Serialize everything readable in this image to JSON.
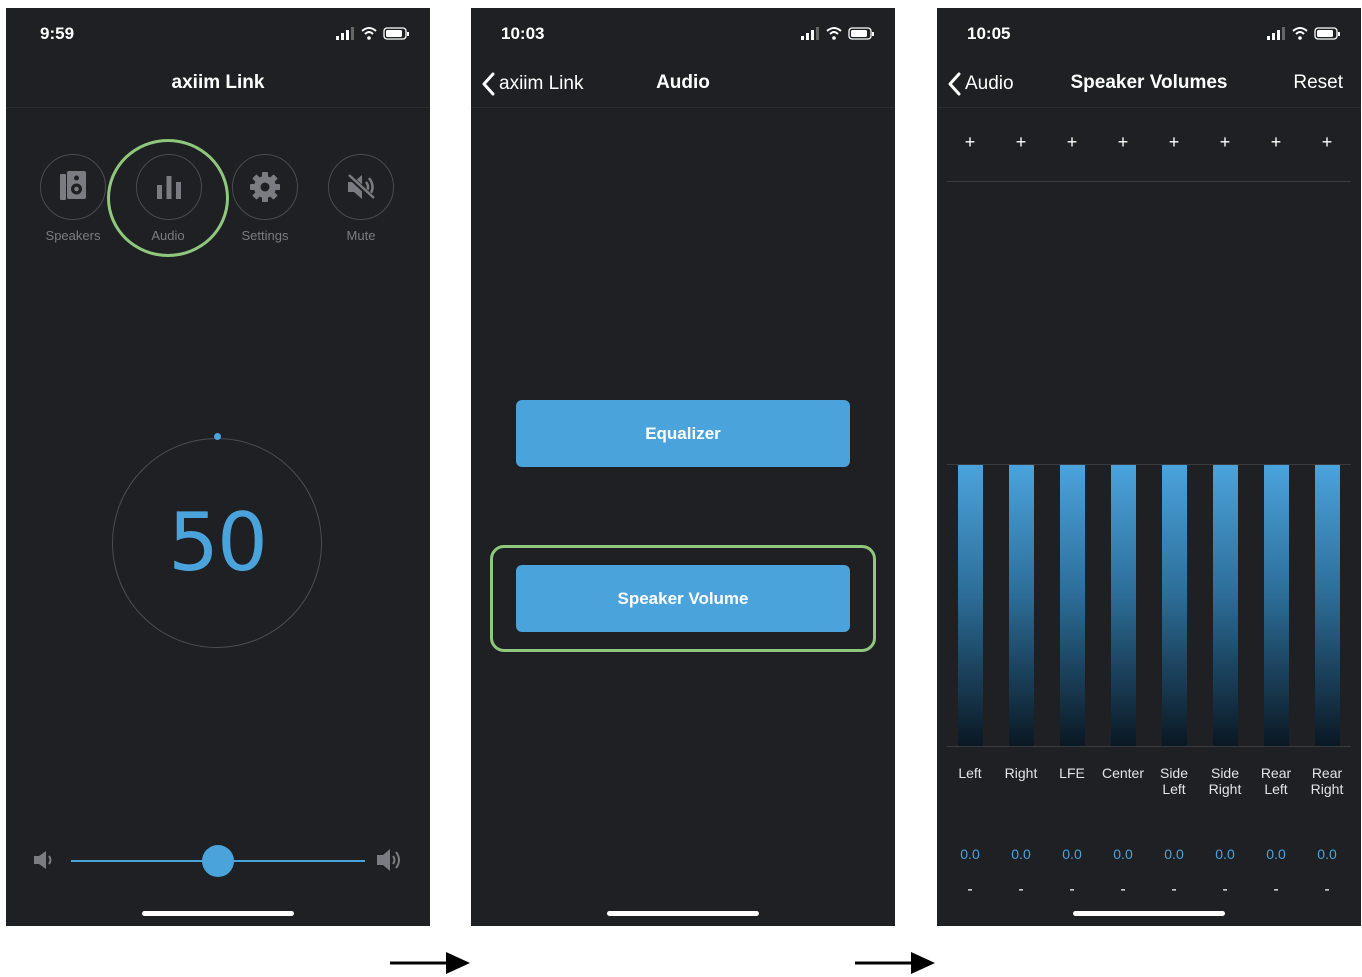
{
  "screens": [
    {
      "time": "9:59",
      "title": "axiim Link",
      "icons": [
        {
          "label": "Speakers",
          "icon": "speaker-icon"
        },
        {
          "label": "Audio",
          "icon": "bar-chart-icon"
        },
        {
          "label": "Settings",
          "icon": "gear-icon"
        },
        {
          "label": "Mute",
          "icon": "mute-icon"
        }
      ],
      "volume": "50",
      "volume_slider_fraction": 0.5
    },
    {
      "time": "10:03",
      "back_label": "axiim Link",
      "title": "Audio",
      "buttons": [
        "Equalizer",
        "Speaker Volume"
      ]
    },
    {
      "time": "10:05",
      "back_label": "Audio",
      "title": "Speaker Volumes",
      "reset_label": "Reset",
      "plus": "+",
      "minus": "-",
      "channels": [
        {
          "name": "Left",
          "value": "0.0"
        },
        {
          "name": "Right",
          "value": "0.0"
        },
        {
          "name": "LFE",
          "value": "0.0"
        },
        {
          "name": "Center",
          "value": "0.0"
        },
        {
          "name": "Side\nLeft",
          "value": "0.0"
        },
        {
          "name": "Side\nRight",
          "value": "0.0"
        },
        {
          "name": "Rear\nLeft",
          "value": "0.0"
        },
        {
          "name": "Rear\nRight",
          "value": "0.0"
        }
      ]
    }
  ],
  "colors": {
    "background": "#1f2023",
    "accent": "#4ba3dc",
    "highlight": "#8fc77c",
    "muted_text": "#7b7c82"
  }
}
